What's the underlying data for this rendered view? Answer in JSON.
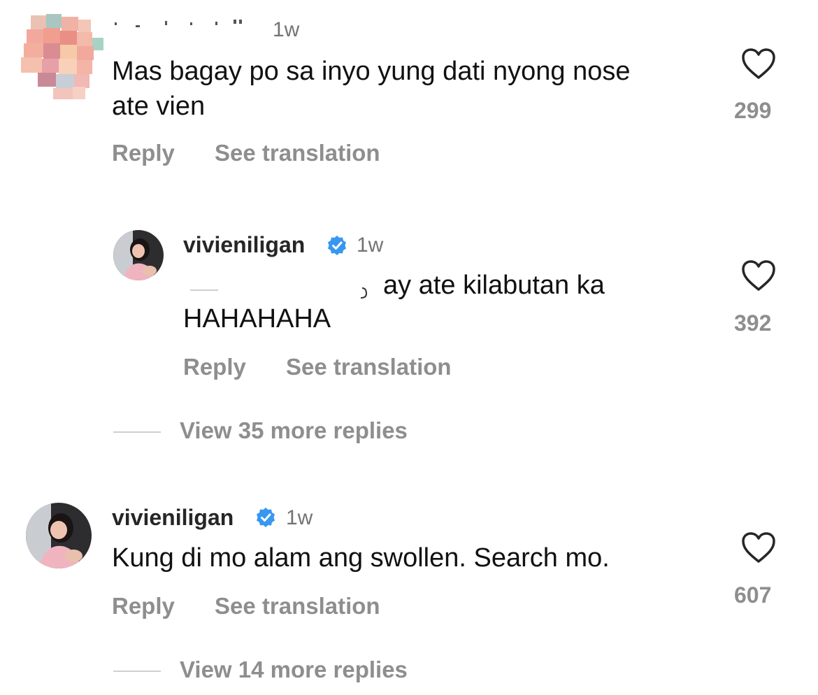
{
  "comments": [
    {
      "username": "",
      "time": "1w",
      "text_line1": "Mas bagay po sa inyo yung dati nyong nose",
      "text_line2": "ate vien",
      "likes": "299",
      "reply_label": "Reply",
      "translate_label": "See translation"
    },
    {
      "username": "vivieniligan",
      "time": "1w",
      "text_line1": "ay ate kilabutan ka",
      "text_line2": "HAHAHAHA",
      "likes": "392",
      "reply_label": "Reply",
      "translate_label": "See translation",
      "view_replies": "View 35 more replies"
    },
    {
      "username": "vivieniligan",
      "time": "1w",
      "text_line1": "Kung di mo alam ang swollen. Search mo.",
      "likes": "607",
      "reply_label": "Reply",
      "translate_label": "See translation",
      "view_replies": "View 14 more replies"
    }
  ],
  "icons": {
    "like": "heart-icon",
    "verified": "verified-badge-icon"
  },
  "colors": {
    "verified_blue": "#3897f0",
    "muted": "#8e8e8e"
  }
}
